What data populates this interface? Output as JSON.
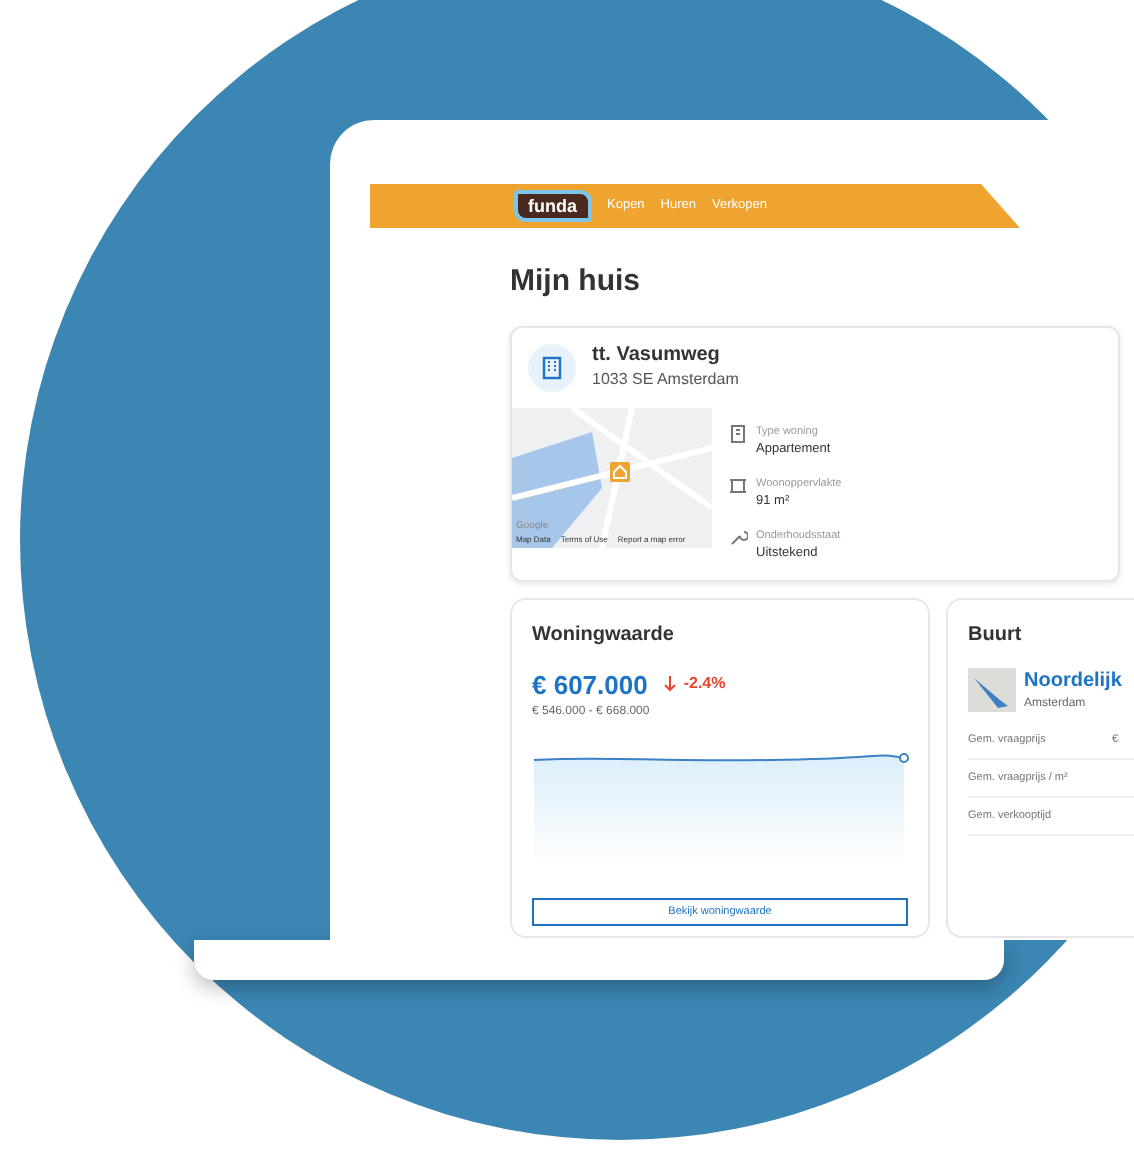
{
  "header": {
    "logo": "funda",
    "nav": [
      {
        "label": "Kopen"
      },
      {
        "label": "Huren"
      },
      {
        "label": "Verkopen"
      }
    ]
  },
  "title": "Mijn huis",
  "house": {
    "street": "tt. Vasumweg",
    "city": "1033 SE Amsterdam",
    "map": {
      "brand": "Google",
      "links": [
        "Map Data",
        "Terms of Use",
        "Report a map error"
      ]
    },
    "facts": [
      {
        "kind": "type",
        "label": "Type woning",
        "value": "Appartement"
      },
      {
        "kind": "area",
        "label": "Woonoppervlakte",
        "value": "91 m²"
      },
      {
        "kind": "condition",
        "label": "Onderhoudsstaat",
        "value": "Uitstekend"
      }
    ]
  },
  "value_card": {
    "title": "Woningwaarde",
    "value": "€ 607.000",
    "change": "-2.4%",
    "range": "€ 546.000 - € 668.000",
    "button": "Bekijk woningwaarde"
  },
  "area_card": {
    "title": "Buurt",
    "name": "Noordelijk",
    "city": "Amsterdam",
    "rows": [
      {
        "label": "Gem. vraagprijs",
        "value": "€"
      },
      {
        "label": "Gem. vraagprijs / m²"
      },
      {
        "label": "Gem. verkooptijd"
      }
    ]
  }
}
